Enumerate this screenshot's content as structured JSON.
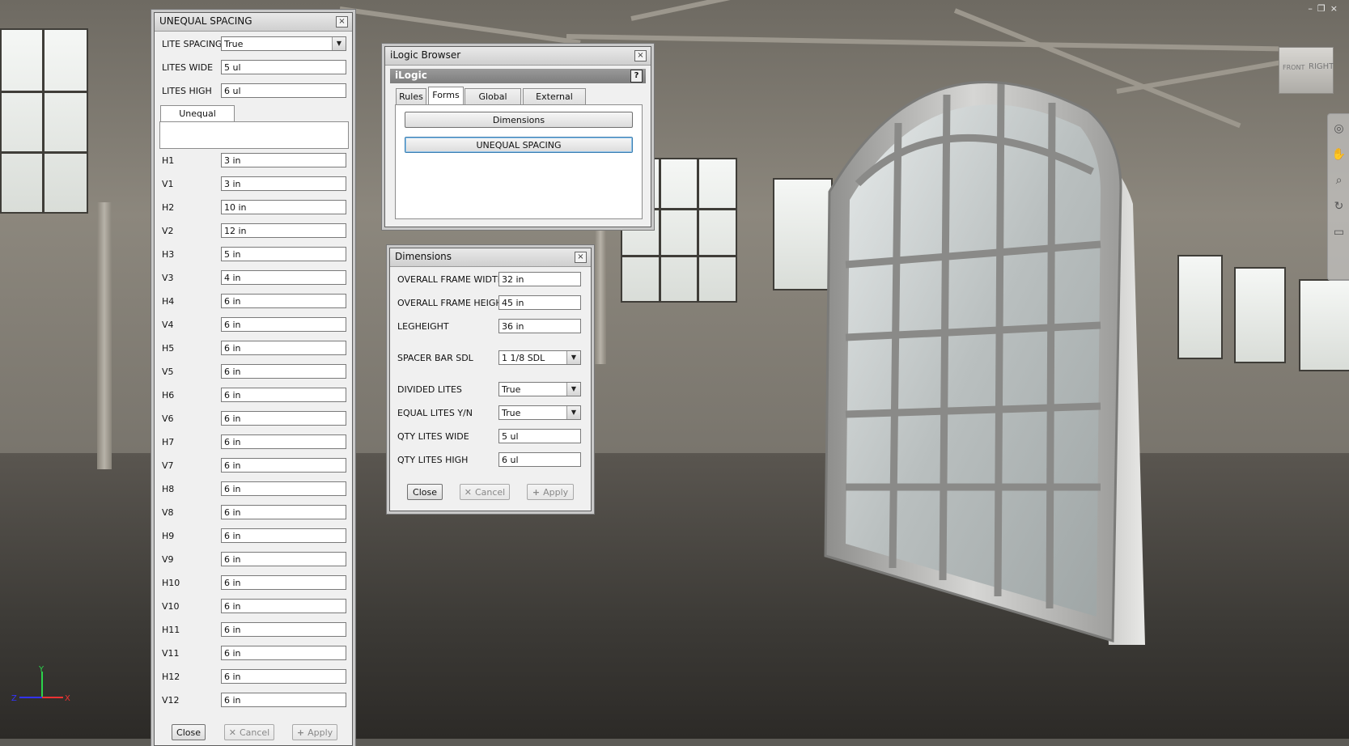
{
  "unequal_spacing": {
    "title": "UNEQUAL SPACING",
    "close_glyph": "×",
    "top_rows": [
      {
        "label": "LITE SPACING",
        "value": "True",
        "type": "combo"
      },
      {
        "label": "LITES WIDE",
        "value": "5 ul",
        "type": "text"
      },
      {
        "label": "LITES HIGH",
        "value": "6 ul",
        "type": "text"
      }
    ],
    "tab_label": "Unequal Spacing",
    "rows": [
      {
        "label": "H1",
        "value": "3 in"
      },
      {
        "label": "V1",
        "value": "3 in"
      },
      {
        "label": "H2",
        "value": "10 in"
      },
      {
        "label": "V2",
        "value": "12 in"
      },
      {
        "label": "H3",
        "value": "5 in"
      },
      {
        "label": "V3",
        "value": "4 in"
      },
      {
        "label": "H4",
        "value": "6 in"
      },
      {
        "label": "V4",
        "value": "6 in"
      },
      {
        "label": "H5",
        "value": "6 in"
      },
      {
        "label": "V5",
        "value": "6 in"
      },
      {
        "label": "H6",
        "value": "6 in"
      },
      {
        "label": "V6",
        "value": "6 in"
      },
      {
        "label": "H7",
        "value": "6 in"
      },
      {
        "label": "V7",
        "value": "6 in"
      },
      {
        "label": "H8",
        "value": "6 in"
      },
      {
        "label": "V8",
        "value": "6 in"
      },
      {
        "label": "H9",
        "value": "6 in"
      },
      {
        "label": "V9",
        "value": "6 in"
      },
      {
        "label": "H10",
        "value": "6 in"
      },
      {
        "label": "V10",
        "value": "6 in"
      },
      {
        "label": "H11",
        "value": "6 in"
      },
      {
        "label": "V11",
        "value": "6 in"
      },
      {
        "label": "H12",
        "value": "6 in"
      },
      {
        "label": "V12",
        "value": "6 in"
      }
    ],
    "buttons": {
      "close": "Close",
      "cancel": "Cancel",
      "apply": "Apply"
    }
  },
  "ilogic_browser": {
    "title": "iLogic Browser",
    "close_glyph": "×",
    "header": "iLogic",
    "help_glyph": "?",
    "tabs": [
      {
        "label": "Rules",
        "active": false
      },
      {
        "label": "Forms",
        "active": true
      },
      {
        "label": "Global Forms",
        "active": false
      },
      {
        "label": "External Rules",
        "active": false
      }
    ],
    "forms": [
      "Dimensions",
      "UNEQUAL SPACING"
    ]
  },
  "dimensions": {
    "title": "Dimensions",
    "close_glyph": "×",
    "rows": [
      {
        "label": "OVERALL FRAME WIDTH",
        "value": "32 in",
        "type": "text"
      },
      {
        "label": "OVERALL FRAME HEIGHT",
        "value": "45 in",
        "type": "text"
      },
      {
        "label": "LEGHEIGHT",
        "value": "36 in",
        "type": "text"
      },
      {
        "label": "SPACER BAR SDL",
        "value": "1 1/8  SDL",
        "type": "combo"
      },
      {
        "label": "DIVIDED LITES",
        "value": "True",
        "type": "combo"
      },
      {
        "label": "EQUAL LITES Y/N",
        "value": "True",
        "type": "combo"
      },
      {
        "label": "QTY LITES WIDE",
        "value": "5 ul",
        "type": "text"
      },
      {
        "label": "QTY LITES HIGH",
        "value": "6 ul",
        "type": "text"
      }
    ],
    "buttons": {
      "close": "Close",
      "cancel": "Cancel",
      "apply": "Apply"
    }
  },
  "viewcube": {
    "front": "FRONT",
    "right": "RIGHT"
  },
  "triad": {
    "x": "X",
    "y": "Y",
    "z": "Z"
  },
  "icons": {
    "close": "close-icon",
    "dropdown": "chevron-down-icon",
    "cancel": "x-icon",
    "apply": "plus-icon",
    "help": "help-icon"
  }
}
